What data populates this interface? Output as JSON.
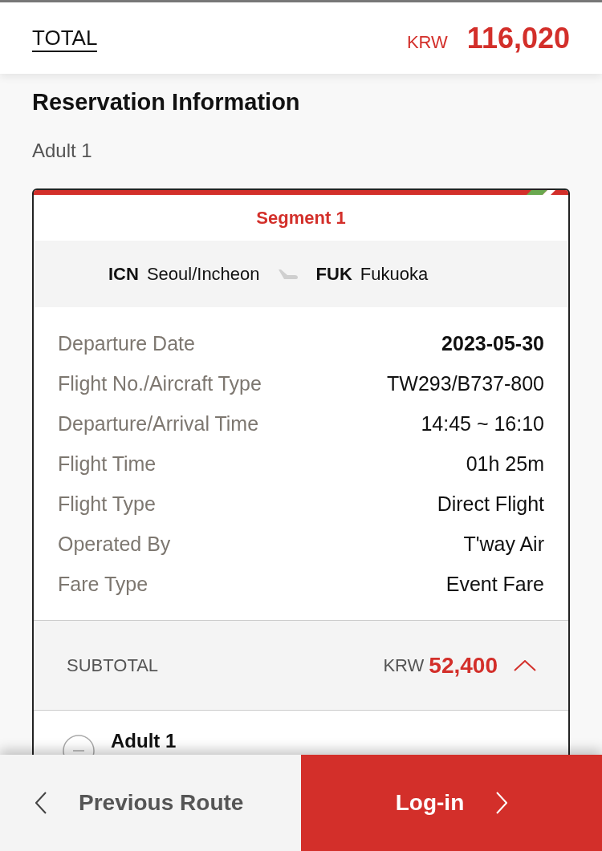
{
  "header": {
    "total_label": "TOTAL",
    "currency": "KRW",
    "amount": "116,020"
  },
  "reservation": {
    "title": "Reservation Information",
    "passenger_summary": "Adult 1"
  },
  "segment": {
    "title": "Segment 1",
    "origin": {
      "code": "ICN",
      "city": "Seoul/Incheon"
    },
    "destination": {
      "code": "FUK",
      "city": "Fukuoka"
    },
    "details": [
      {
        "label": "Departure Date",
        "value": "2023-05-30",
        "emphasized": true
      },
      {
        "label": "Flight No./Aircraft Type",
        "value": "TW293/B737-800",
        "emphasized": false
      },
      {
        "label": "Departure/Arrival Time",
        "value": "14:45 ~ 16:10",
        "emphasized": false
      },
      {
        "label": "Flight Time",
        "value": "01h 25m",
        "emphasized": false
      },
      {
        "label": "Flight Type",
        "value": "Direct Flight",
        "emphasized": false
      },
      {
        "label": "Operated By",
        "value": "T'way Air",
        "emphasized": false
      },
      {
        "label": "Fare Type",
        "value": "Event Fare",
        "emphasized": false
      }
    ],
    "subtotal": {
      "label": "SUBTOTAL",
      "currency": "KRW",
      "amount": "52,400",
      "expanded": true
    },
    "passengers": [
      {
        "label": "Adult 1",
        "expanded": true
      }
    ]
  },
  "footer": {
    "buttons": [
      {
        "kind": "back",
        "label": "Previous Route"
      },
      {
        "kind": "next",
        "label": "Log-in"
      }
    ]
  }
}
